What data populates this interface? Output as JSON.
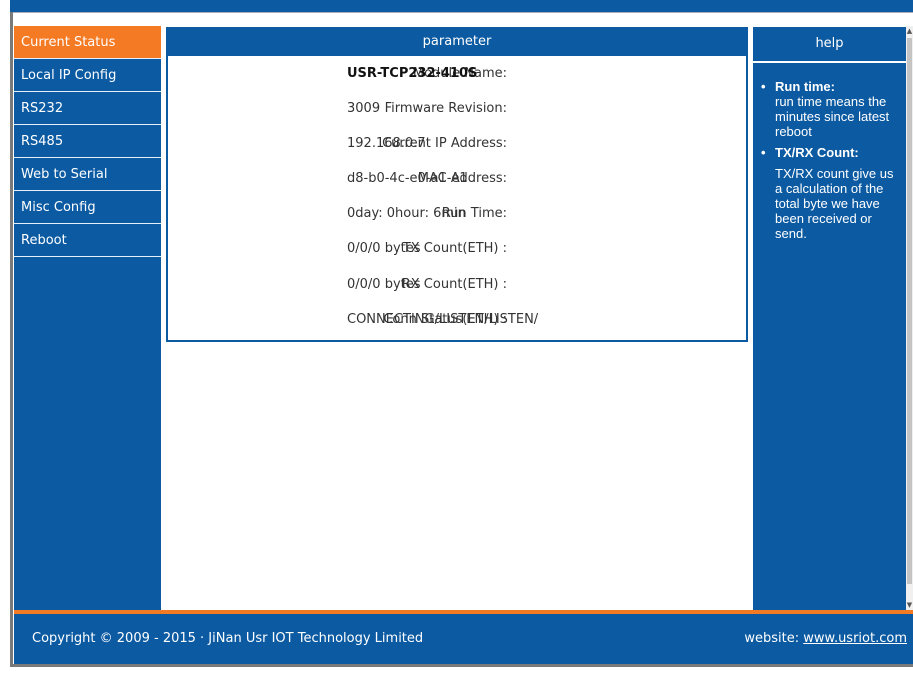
{
  "sidebar": {
    "items": [
      {
        "label": "Current Status",
        "active": true
      },
      {
        "label": "Local IP Config"
      },
      {
        "label": "RS232"
      },
      {
        "label": "RS485"
      },
      {
        "label": "Web to Serial"
      },
      {
        "label": "Misc Config"
      },
      {
        "label": "Reboot"
      }
    ]
  },
  "parameter": {
    "header": "parameter",
    "rows": [
      {
        "label": "Module Name:",
        "value": "USR-TCP232-410S"
      },
      {
        "label": "Firmware Revision:",
        "value": "3009"
      },
      {
        "label": "Current IP Address:",
        "value": "192.168.0.7"
      },
      {
        "label": "MAC Address:",
        "value": "d8-b0-4c-e0-a1-e1"
      },
      {
        "label": "Run Time:",
        "value": "0day: 0hour: 6min"
      },
      {
        "label": "TX Count(ETH) :",
        "value": "0/0/0 bytes"
      },
      {
        "label": "RX Count(ETH) :",
        "value": "0/0/0 bytes"
      },
      {
        "label": "Conn Status(ETH) :",
        "value": "CONNECTING/LISTEN/LISTEN/"
      }
    ]
  },
  "help": {
    "header": "help",
    "items": [
      {
        "title": "Run time:",
        "text": "run time means the minutes since latest reboot"
      },
      {
        "title": "TX/RX Count:",
        "text": "TX/RX count give us a calculation of the total byte we have been received or send."
      }
    ]
  },
  "footer": {
    "copyright": "Copyright © 2009 - 2015 · JiNan Usr IOT Technology Limited",
    "website_label": "website:",
    "website_link": "www.usriot.com"
  },
  "colors": {
    "primary_blue": "#0b5aa2",
    "accent_orange": "#f47a24"
  }
}
